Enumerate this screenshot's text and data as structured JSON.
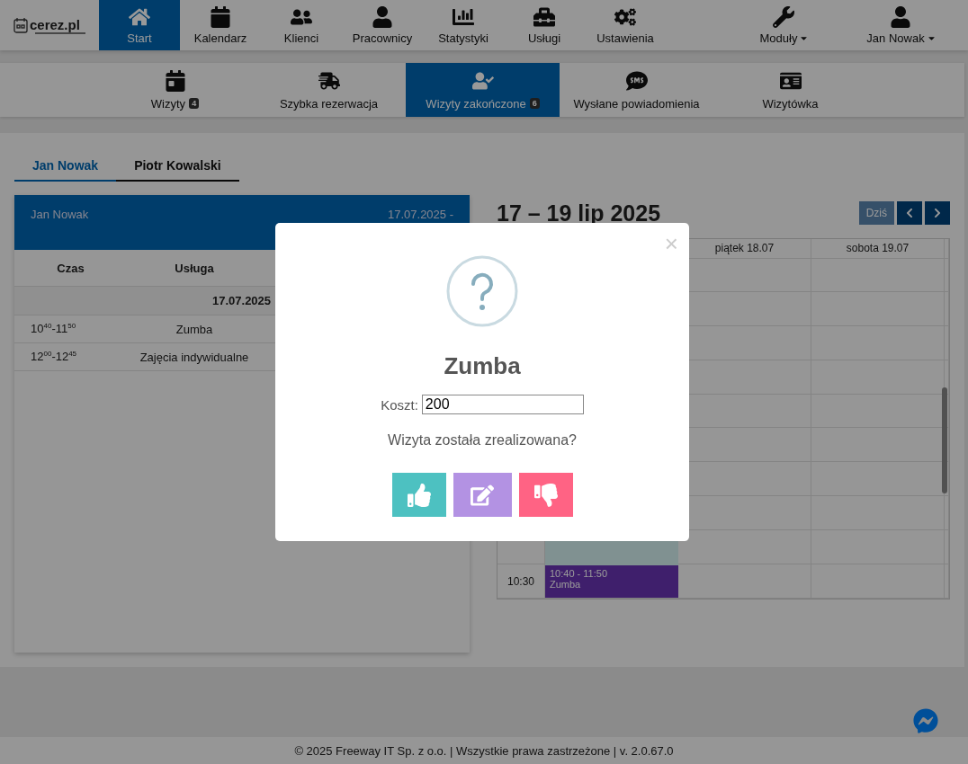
{
  "logo": {
    "name": "cerez.pl"
  },
  "nav": {
    "items": [
      {
        "kind": "home",
        "label": "Start",
        "selected": true
      },
      {
        "kind": "calendar",
        "label": "Kalendarz",
        "selected": false
      },
      {
        "kind": "clients",
        "label": "Klienci",
        "selected": false
      },
      {
        "kind": "user",
        "label": "Pracownicy",
        "selected": false
      },
      {
        "kind": "chart",
        "label": "Statystyki",
        "selected": false
      },
      {
        "kind": "toolbox",
        "label": "Usługi",
        "selected": false
      },
      {
        "kind": "cogs",
        "label": "Ustawienia",
        "selected": false
      }
    ],
    "right": [
      {
        "kind": "wrench",
        "label": "Moduły"
      },
      {
        "kind": "user",
        "label": "Jan Nowak"
      }
    ]
  },
  "subnav": [
    {
      "kind": "calendar",
      "label": "Wizyty",
      "badge": "4",
      "selected": false
    },
    {
      "kind": "truck",
      "label": "Szybka rezerwacja",
      "selected": false
    },
    {
      "kind": "usercheck",
      "label": "Wizyty zakończone",
      "badge": "6",
      "selected": true
    },
    {
      "kind": "sms",
      "label": "Wysłane powiadomienia",
      "selected": false
    },
    {
      "kind": "card",
      "label": "Wizytówka",
      "selected": false
    }
  ],
  "employee_tabs": [
    {
      "label": "Jan Nowak",
      "selected": true
    },
    {
      "label": "Piotr Kowalski",
      "selected": false
    }
  ],
  "panel": {
    "name": "Jan Nowak",
    "date_range": "17.07.2025 -",
    "columns": [
      "Czas",
      "Usługa"
    ],
    "date_row": "17.07.2025",
    "rows": [
      {
        "time": "10$^{40}$-11$^{50}$",
        "service": "Zumba"
      },
      {
        "time": "12$^{00}$-12$^{45}$",
        "service": "Zajęcia indywidualne"
      }
    ]
  },
  "calendar": {
    "title": "17 – 19 lip 2025",
    "today": {
      "label": "Dziś",
      "disabled": true
    },
    "days": [
      "piątek 18.07",
      "sobota 19.07"
    ],
    "visible_time": "10:30",
    "events": [
      {
        "kind": "highlight"
      },
      {
        "kind": "appointment",
        "time": "10:40 - 11:50",
        "title": "Zumba"
      }
    ]
  },
  "modal": {
    "close": "×",
    "title": "Zumba",
    "cost_label": "Koszt:",
    "cost_value": "200",
    "question": "Wizyta została zrealizowana?",
    "actions": [
      {
        "kind": "confirm",
        "color": "#4dc1c1"
      },
      {
        "kind": "edit",
        "color": "#b392e3"
      },
      {
        "kind": "reject",
        "color": "#ff6384"
      }
    ]
  },
  "footer": "© 2025 Freeway IT Sp. z o.o. | Wszystkie prawa zastrzeżone | v. 2.0.67.0"
}
